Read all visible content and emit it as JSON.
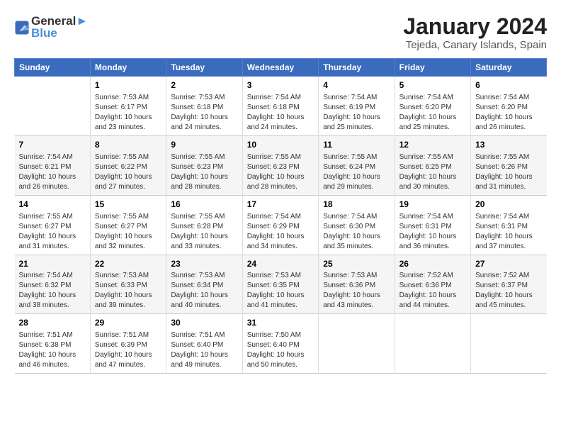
{
  "logo": {
    "line1": "General",
    "line2": "Blue"
  },
  "title": "January 2024",
  "subtitle": "Tejeda, Canary Islands, Spain",
  "headers": [
    "Sunday",
    "Monday",
    "Tuesday",
    "Wednesday",
    "Thursday",
    "Friday",
    "Saturday"
  ],
  "weeks": [
    [
      {
        "num": "",
        "info": ""
      },
      {
        "num": "1",
        "info": "Sunrise: 7:53 AM\nSunset: 6:17 PM\nDaylight: 10 hours\nand 23 minutes."
      },
      {
        "num": "2",
        "info": "Sunrise: 7:53 AM\nSunset: 6:18 PM\nDaylight: 10 hours\nand 24 minutes."
      },
      {
        "num": "3",
        "info": "Sunrise: 7:54 AM\nSunset: 6:18 PM\nDaylight: 10 hours\nand 24 minutes."
      },
      {
        "num": "4",
        "info": "Sunrise: 7:54 AM\nSunset: 6:19 PM\nDaylight: 10 hours\nand 25 minutes."
      },
      {
        "num": "5",
        "info": "Sunrise: 7:54 AM\nSunset: 6:20 PM\nDaylight: 10 hours\nand 25 minutes."
      },
      {
        "num": "6",
        "info": "Sunrise: 7:54 AM\nSunset: 6:20 PM\nDaylight: 10 hours\nand 26 minutes."
      }
    ],
    [
      {
        "num": "7",
        "info": "Sunrise: 7:54 AM\nSunset: 6:21 PM\nDaylight: 10 hours\nand 26 minutes."
      },
      {
        "num": "8",
        "info": "Sunrise: 7:55 AM\nSunset: 6:22 PM\nDaylight: 10 hours\nand 27 minutes."
      },
      {
        "num": "9",
        "info": "Sunrise: 7:55 AM\nSunset: 6:23 PM\nDaylight: 10 hours\nand 28 minutes."
      },
      {
        "num": "10",
        "info": "Sunrise: 7:55 AM\nSunset: 6:23 PM\nDaylight: 10 hours\nand 28 minutes."
      },
      {
        "num": "11",
        "info": "Sunrise: 7:55 AM\nSunset: 6:24 PM\nDaylight: 10 hours\nand 29 minutes."
      },
      {
        "num": "12",
        "info": "Sunrise: 7:55 AM\nSunset: 6:25 PM\nDaylight: 10 hours\nand 30 minutes."
      },
      {
        "num": "13",
        "info": "Sunrise: 7:55 AM\nSunset: 6:26 PM\nDaylight: 10 hours\nand 31 minutes."
      }
    ],
    [
      {
        "num": "14",
        "info": "Sunrise: 7:55 AM\nSunset: 6:27 PM\nDaylight: 10 hours\nand 31 minutes."
      },
      {
        "num": "15",
        "info": "Sunrise: 7:55 AM\nSunset: 6:27 PM\nDaylight: 10 hours\nand 32 minutes."
      },
      {
        "num": "16",
        "info": "Sunrise: 7:55 AM\nSunset: 6:28 PM\nDaylight: 10 hours\nand 33 minutes."
      },
      {
        "num": "17",
        "info": "Sunrise: 7:54 AM\nSunset: 6:29 PM\nDaylight: 10 hours\nand 34 minutes."
      },
      {
        "num": "18",
        "info": "Sunrise: 7:54 AM\nSunset: 6:30 PM\nDaylight: 10 hours\nand 35 minutes."
      },
      {
        "num": "19",
        "info": "Sunrise: 7:54 AM\nSunset: 6:31 PM\nDaylight: 10 hours\nand 36 minutes."
      },
      {
        "num": "20",
        "info": "Sunrise: 7:54 AM\nSunset: 6:31 PM\nDaylight: 10 hours\nand 37 minutes."
      }
    ],
    [
      {
        "num": "21",
        "info": "Sunrise: 7:54 AM\nSunset: 6:32 PM\nDaylight: 10 hours\nand 38 minutes."
      },
      {
        "num": "22",
        "info": "Sunrise: 7:53 AM\nSunset: 6:33 PM\nDaylight: 10 hours\nand 39 minutes."
      },
      {
        "num": "23",
        "info": "Sunrise: 7:53 AM\nSunset: 6:34 PM\nDaylight: 10 hours\nand 40 minutes."
      },
      {
        "num": "24",
        "info": "Sunrise: 7:53 AM\nSunset: 6:35 PM\nDaylight: 10 hours\nand 41 minutes."
      },
      {
        "num": "25",
        "info": "Sunrise: 7:53 AM\nSunset: 6:36 PM\nDaylight: 10 hours\nand 43 minutes."
      },
      {
        "num": "26",
        "info": "Sunrise: 7:52 AM\nSunset: 6:36 PM\nDaylight: 10 hours\nand 44 minutes."
      },
      {
        "num": "27",
        "info": "Sunrise: 7:52 AM\nSunset: 6:37 PM\nDaylight: 10 hours\nand 45 minutes."
      }
    ],
    [
      {
        "num": "28",
        "info": "Sunrise: 7:51 AM\nSunset: 6:38 PM\nDaylight: 10 hours\nand 46 minutes."
      },
      {
        "num": "29",
        "info": "Sunrise: 7:51 AM\nSunset: 6:39 PM\nDaylight: 10 hours\nand 47 minutes."
      },
      {
        "num": "30",
        "info": "Sunrise: 7:51 AM\nSunset: 6:40 PM\nDaylight: 10 hours\nand 49 minutes."
      },
      {
        "num": "31",
        "info": "Sunrise: 7:50 AM\nSunset: 6:40 PM\nDaylight: 10 hours\nand 50 minutes."
      },
      {
        "num": "",
        "info": ""
      },
      {
        "num": "",
        "info": ""
      },
      {
        "num": "",
        "info": ""
      }
    ]
  ]
}
